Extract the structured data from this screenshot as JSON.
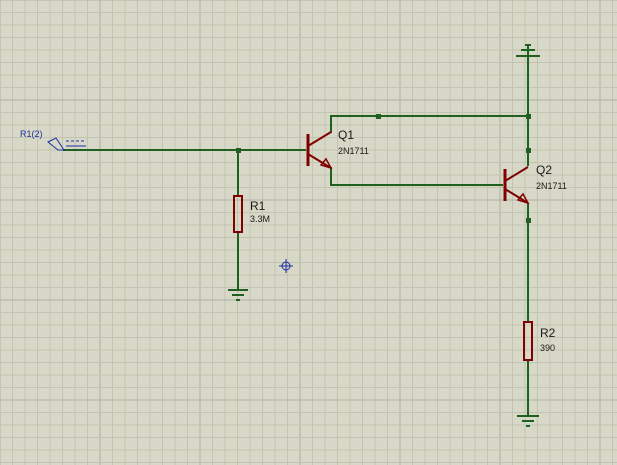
{
  "theme": {
    "background": "#d8d8c8",
    "grid_minor": "#c3c3b2",
    "grid_major": "#b0b0a0",
    "wire": "#1f5f1f",
    "component": "#800000",
    "label_text": "#1a1a1a",
    "terminal_blue": "#1a2fa0"
  },
  "terminal": {
    "label": "R1(2)"
  },
  "components": {
    "q1": {
      "ref": "Q1",
      "value": "2N1711"
    },
    "q2": {
      "ref": "Q2",
      "value": "2N1711"
    },
    "r1": {
      "ref": "R1",
      "value": "3.3M"
    },
    "r2": {
      "ref": "R2",
      "value": "390"
    }
  },
  "cursor": {
    "icon": "crosshair-icon"
  },
  "grounds": [
    "ground-r1",
    "ground-r2"
  ],
  "power": [
    "power-top"
  ]
}
